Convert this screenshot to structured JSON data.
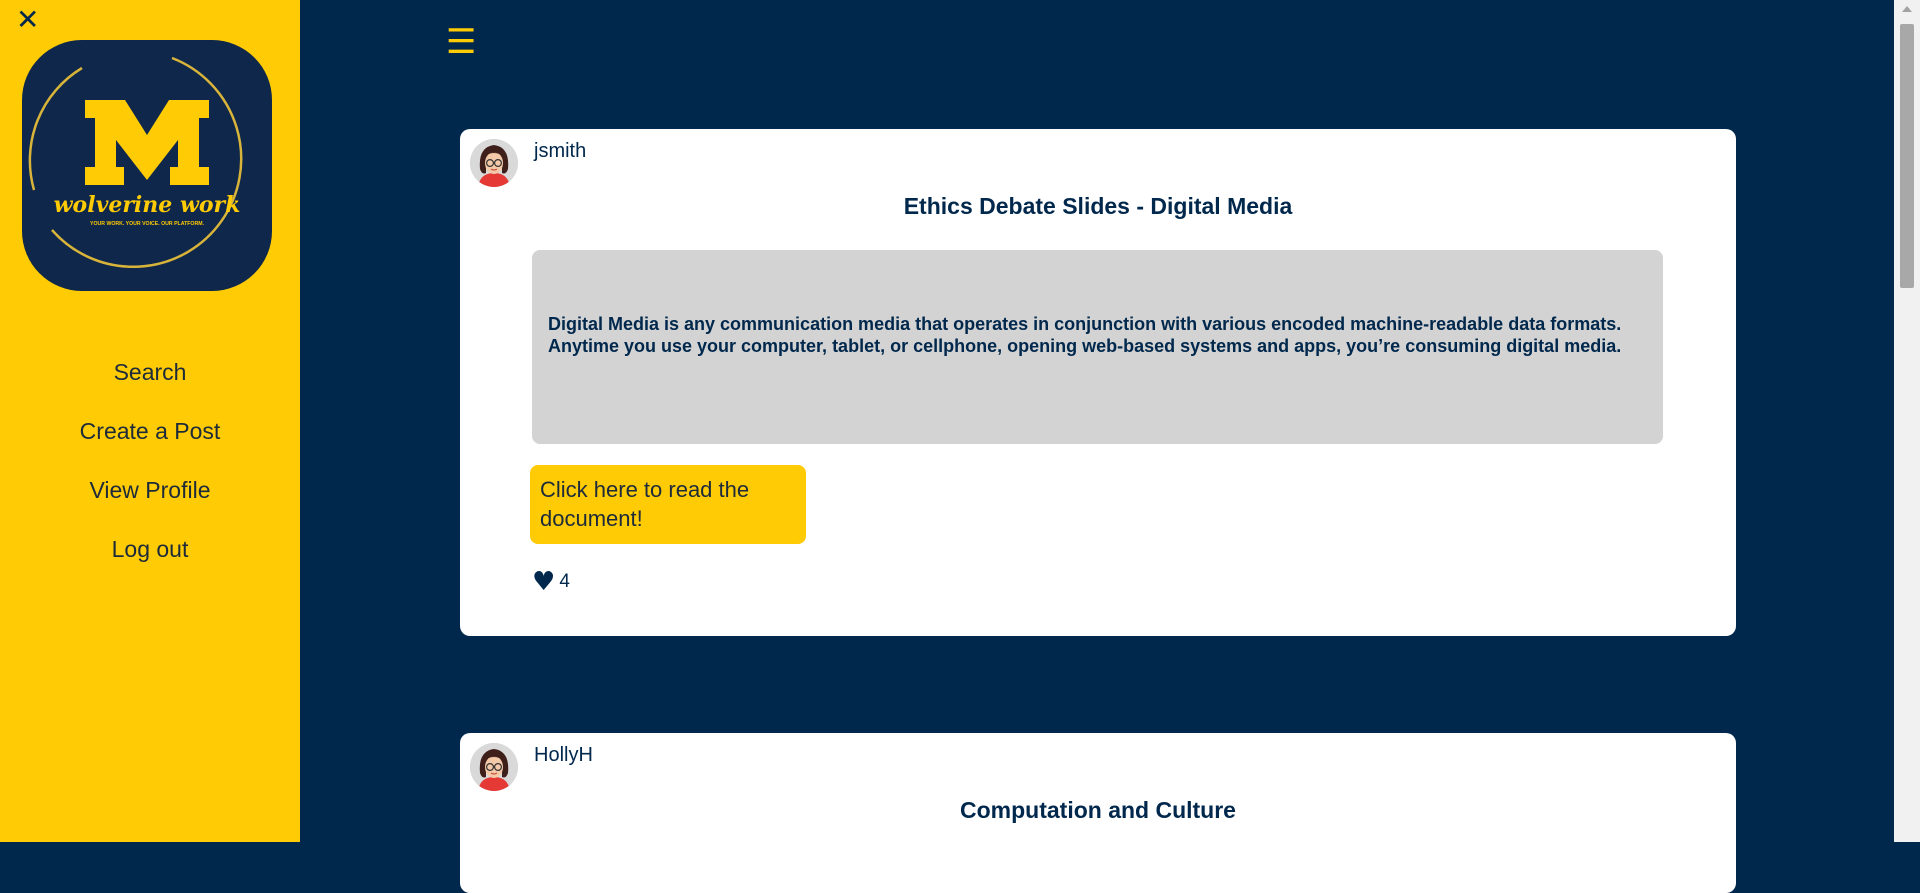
{
  "sidebar": {
    "close_icon": "✕",
    "logo": {
      "letter": "M",
      "script_text": "wolverine work",
      "tagline": "YOUR WORK. YOUR VOICE. OUR PLATFORM."
    },
    "items": [
      {
        "label": "Search"
      },
      {
        "label": "Create a Post"
      },
      {
        "label": "View Profile"
      },
      {
        "label": "Log out"
      }
    ]
  },
  "header": {
    "menu_icon": "☰"
  },
  "posts": [
    {
      "username": "jsmith",
      "title": "Ethics Debate Slides - Digital Media",
      "excerpt": "Digital Media is any communication media that operates in conjunction with various encoded machine-readable data formats. Anytime you use your computer, tablet, or cellphone, opening web-based systems and apps, you’re consuming digital media.",
      "button_label": "Click here to read the document!",
      "like_icon": "♥",
      "likes": "4"
    },
    {
      "username": "HollyH",
      "title": "Computation and Culture"
    }
  ],
  "colors": {
    "navy": "#00274C",
    "maize": "#FFCB05",
    "excerpt_bg": "#D3D3D3"
  }
}
